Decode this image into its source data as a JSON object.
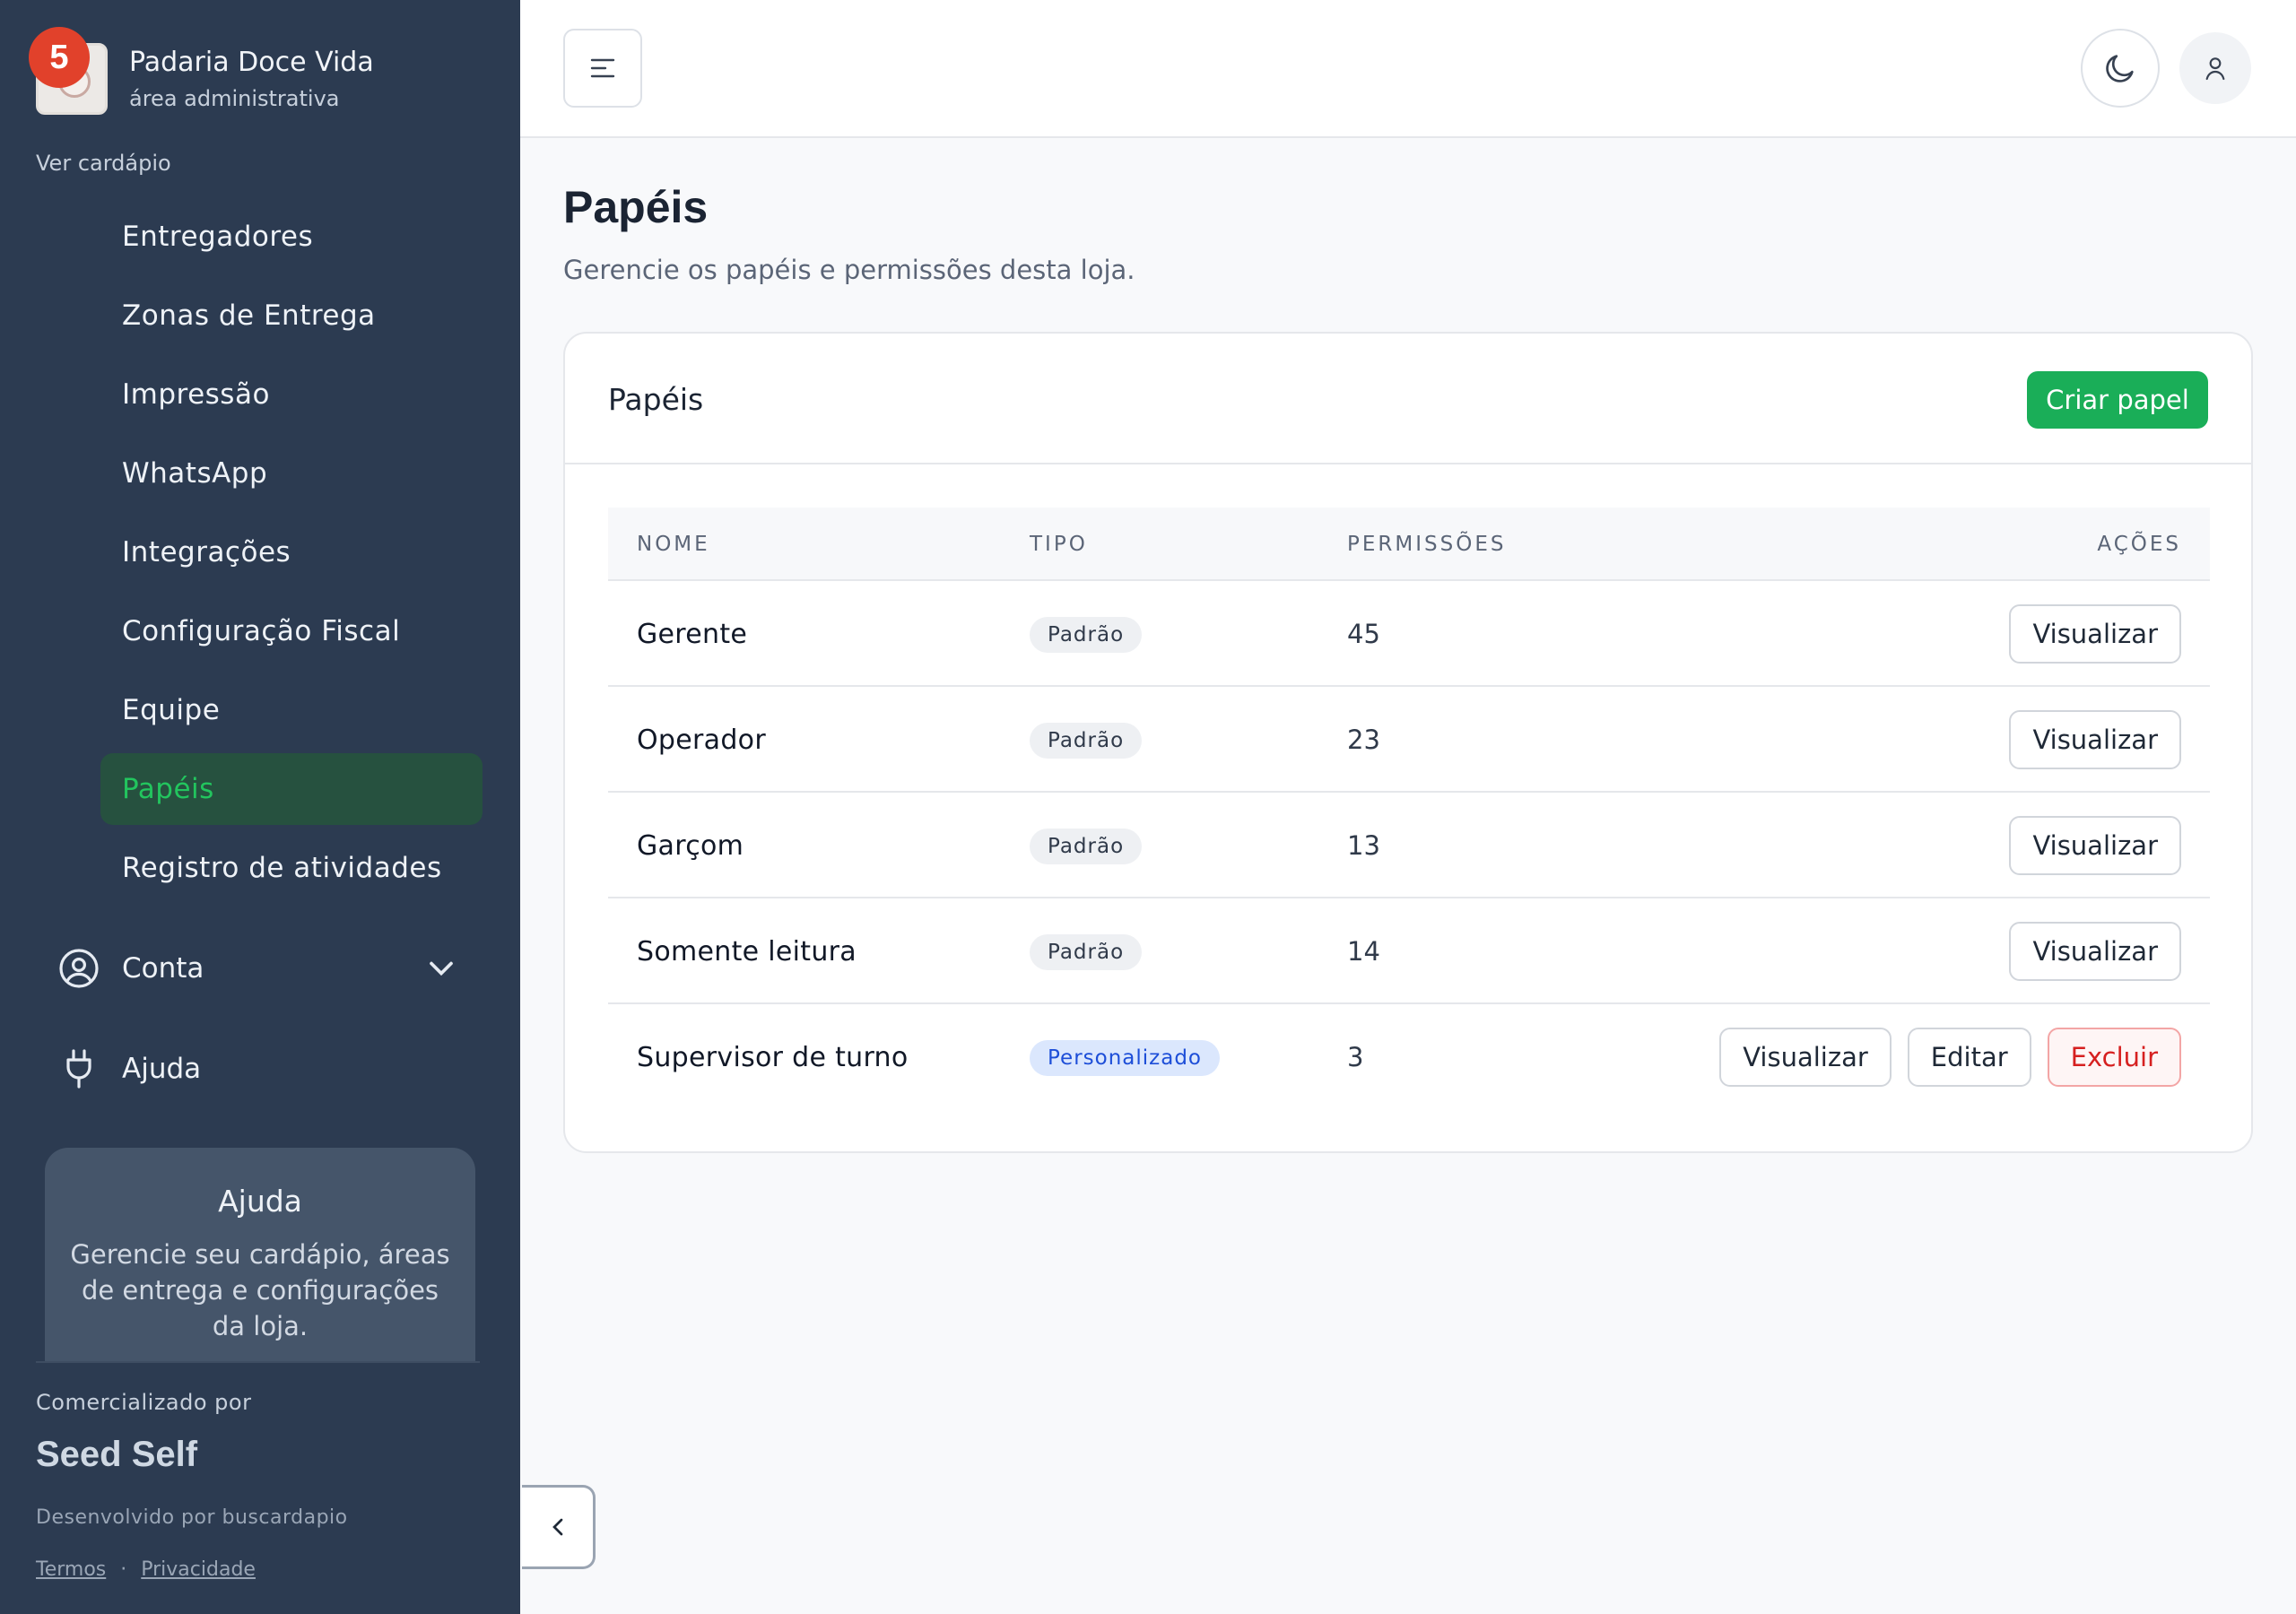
{
  "brand": {
    "name": "Padaria Doce Vida",
    "subtitle": "área administrativa",
    "badge_count": "5"
  },
  "sidebar": {
    "ver_cardapio": "Ver cardápio",
    "items": [
      {
        "label": "Entregadores"
      },
      {
        "label": "Zonas de Entrega"
      },
      {
        "label": "Impressão"
      },
      {
        "label": "WhatsApp"
      },
      {
        "label": "Integrações"
      },
      {
        "label": "Configuração Fiscal"
      },
      {
        "label": "Equipe"
      },
      {
        "label": "Papéis",
        "active": true
      },
      {
        "label": "Registro de atividades"
      }
    ],
    "account_label": "Conta",
    "help_label": "Ajuda",
    "help_card": {
      "title": "Ajuda",
      "text": "Gerencie seu cardápio, áreas de entrega e configurações da loja."
    },
    "footer": {
      "marketed_by": "Comercializado por",
      "brand": "Seed Self",
      "developed_by": "Desenvolvido por buscardapio",
      "terms": "Termos",
      "separator": "·",
      "privacy": "Privacidade"
    }
  },
  "page": {
    "title": "Papéis",
    "subtitle": "Gerencie os papéis e permissões desta loja."
  },
  "card": {
    "title": "Papéis",
    "create_label": "Criar papel",
    "columns": {
      "name": "NOME",
      "type": "TIPO",
      "permissions": "PERMISSÕES",
      "actions": "AÇÕES"
    },
    "rows": [
      {
        "name": "Gerente",
        "type": "Padrão",
        "permissions": "45",
        "view": "Visualizar"
      },
      {
        "name": "Operador",
        "type": "Padrão",
        "permissions": "23",
        "view": "Visualizar"
      },
      {
        "name": "Garçom",
        "type": "Padrão",
        "permissions": "13",
        "view": "Visualizar"
      },
      {
        "name": "Somente leitura",
        "type": "Padrão",
        "permissions": "14",
        "view": "Visualizar"
      },
      {
        "name": "Supervisor de turno",
        "type": "Personalizado",
        "permissions": "3",
        "view": "Visualizar",
        "edit": "Editar",
        "delete": "Excluir"
      }
    ]
  },
  "colors": {
    "sidebar_bg": "#2c3b51",
    "accent_green": "#1aae58",
    "active_text": "#22c55e",
    "danger": "#d62020",
    "badge_custom": "#1d4ed8"
  },
  "icons": [
    "menu-icon",
    "moon-icon",
    "user-icon",
    "user-circle-icon",
    "chevron-down-icon",
    "plug-icon",
    "chevron-left-icon"
  ]
}
